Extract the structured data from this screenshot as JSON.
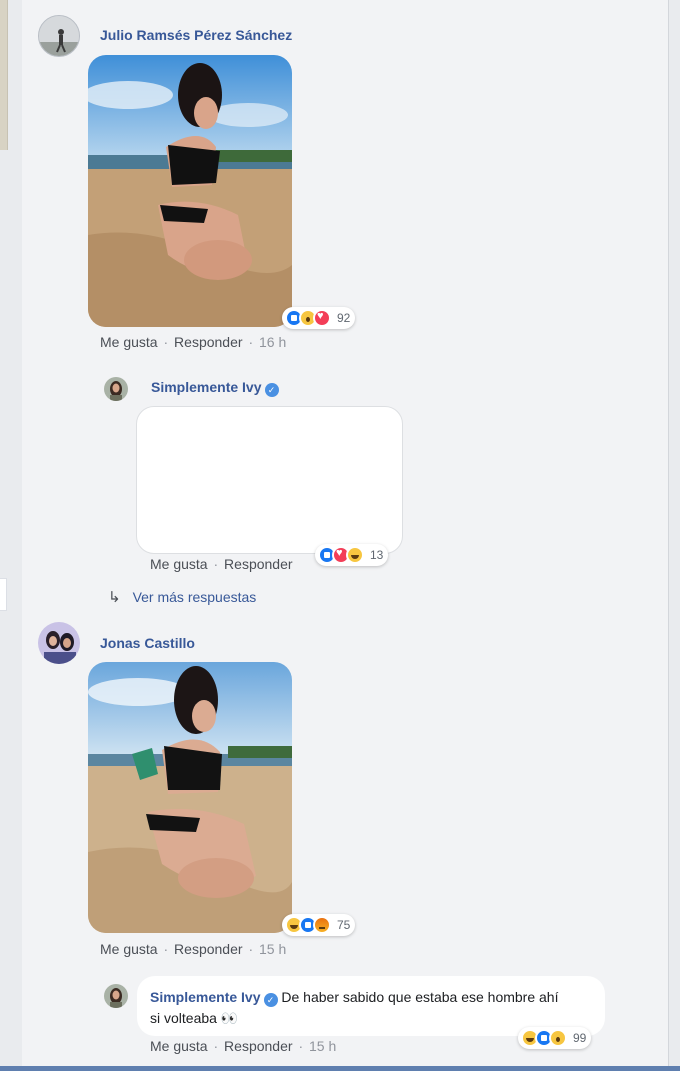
{
  "comments": [
    {
      "author": "Julio Ramsés Pérez Sánchez",
      "reactions": {
        "icons": [
          "like-icon",
          "wow-icon",
          "love-icon"
        ],
        "count": "92"
      },
      "actions": {
        "like": "Me gusta",
        "reply": "Responder",
        "time": "16 h"
      },
      "reply": {
        "author": "Simplemente Ivy",
        "reactions": {
          "icons": [
            "like-icon",
            "love-icon",
            "haha-icon"
          ],
          "count": "13"
        },
        "actions": {
          "like": "Me gusta",
          "reply": "Responder"
        }
      },
      "more_replies": "Ver más respuestas"
    },
    {
      "author": "Jonas Castillo",
      "reactions": {
        "icons": [
          "haha-icon",
          "like-icon",
          "angry-icon"
        ],
        "count": "75"
      },
      "actions": {
        "like": "Me gusta",
        "reply": "Responder",
        "time": "15 h"
      },
      "reply": {
        "author": "Simplemente Ivy",
        "text": "De haber sabido que estaba ese hombre ahí si volteaba 👀",
        "reactions": {
          "icons": [
            "haha-icon",
            "like-icon",
            "wow-icon"
          ],
          "count": "99"
        },
        "actions": {
          "like": "Me gusta",
          "reply": "Responder",
          "time": "15 h"
        }
      }
    }
  ],
  "colors": {
    "link": "#385898",
    "background": "#f2f3f5",
    "accent": "#1877f2"
  }
}
